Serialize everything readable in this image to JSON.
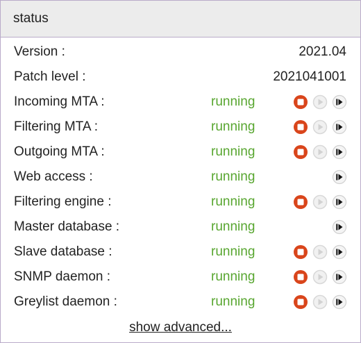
{
  "panel": {
    "title": "status"
  },
  "info": [
    {
      "label": "Version :",
      "value": "2021.04"
    },
    {
      "label": "Patch level :",
      "value": "2021041001"
    }
  ],
  "services": [
    {
      "label": "Incoming MTA :",
      "status": "running",
      "controls": [
        "stop-icon",
        "play-icon",
        "restart-icon"
      ]
    },
    {
      "label": "Filtering MTA :",
      "status": "running",
      "controls": [
        "stop-icon",
        "play-icon",
        "restart-icon"
      ]
    },
    {
      "label": "Outgoing MTA :",
      "status": "running",
      "controls": [
        "stop-icon",
        "play-icon",
        "restart-icon"
      ]
    },
    {
      "label": "Web access :",
      "status": "running",
      "controls": [
        "restart-icon"
      ]
    },
    {
      "label": "Filtering engine :",
      "status": "running",
      "controls": [
        "stop-icon",
        "play-icon",
        "restart-icon"
      ]
    },
    {
      "label": "Master database :",
      "status": "running",
      "controls": [
        "restart-icon"
      ]
    },
    {
      "label": "Slave database :",
      "status": "running",
      "controls": [
        "stop-icon",
        "play-icon",
        "restart-icon"
      ]
    },
    {
      "label": "SNMP daemon :",
      "status": "running",
      "controls": [
        "stop-icon",
        "play-icon",
        "restart-icon"
      ]
    },
    {
      "label": "Greylist daemon :",
      "status": "running",
      "controls": [
        "stop-icon",
        "play-icon",
        "restart-icon"
      ]
    }
  ],
  "footer": {
    "link": "show advanced..."
  },
  "colors": {
    "running": "#58a630",
    "stop": "#d9451b",
    "play_disabled": "#d8d8d8",
    "restart": "#111111",
    "border": "#b9abc9",
    "header_bg": "#ececec"
  }
}
